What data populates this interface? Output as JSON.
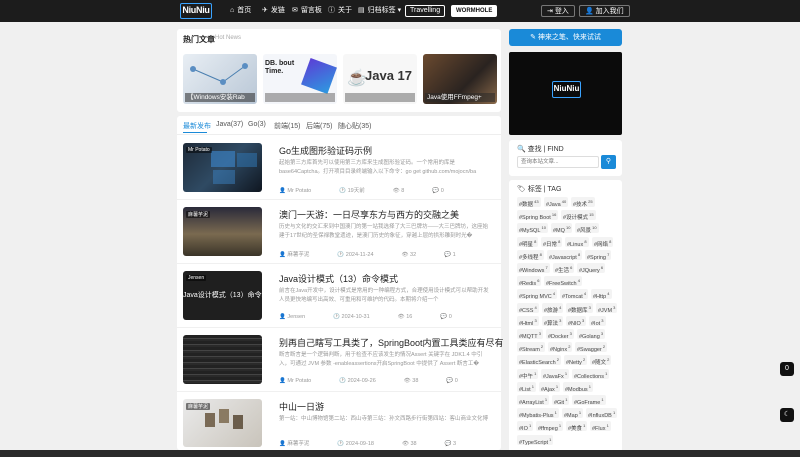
{
  "nav": {
    "logo": "NiuNiu",
    "items": [
      {
        "icon": "home-icon",
        "glyph": "⌂",
        "label": "首页"
      },
      {
        "icon": "send-icon",
        "glyph": "✈",
        "label": "发链"
      },
      {
        "icon": "message-icon",
        "glyph": "✉",
        "label": "留言板"
      },
      {
        "icon": "info-icon",
        "glyph": "ⓘ",
        "label": "关于"
      },
      {
        "icon": "archive-icon",
        "glyph": "▤",
        "label": "归档标签 ▾"
      }
    ],
    "travelling": "Travelling",
    "wormhole": "WORMHOLE",
    "login": "登入",
    "join": "加入我们"
  },
  "hot": {
    "title": "热门文章",
    "subtitle": "Hot News",
    "cards": [
      "【Windows安装Rab",
      "DB. bout Time.",
      "Java 17",
      "Java使用FFmpeg+"
    ]
  },
  "tabs": [
    "最新发布",
    "Java(37)",
    "Go(3)",
    "前端(15)",
    "后端(75)",
    "随心贴(35)"
  ],
  "articles": [
    {
      "thumb_tag": "Mr Potato",
      "title": "Go生成图形验证码示例",
      "desc": "起始第三方库首先可以使用第三方库来生成图形验证码。一个常用的库是base64Captcha。打开项目目录终端输入以下命令：go get github.com/mojocn/ba",
      "author": "Mr Potato",
      "date": "19天前",
      "views": "8",
      "comments": "0"
    },
    {
      "thumb_tag": "麻薯芋泥",
      "title": "澳门一天游：一日尽享东方与西方的交融之美",
      "desc": "历史与文化的交汇来到中国澳门的第一站我选择了大三巴牌坊——大三巴牌坊，这座始建于17世纪的圣保禄教堂遗迹，是澳门历史的象征，穿越上层的拱形雕刻时光�",
      "author": "麻薯芋泥",
      "date": "2024-11-24",
      "views": "32",
      "comments": "1"
    },
    {
      "thumb_tag": "Jensen",
      "title": "Java设计模式（13）命令模式",
      "desc": "前言在Java开发中，设计模式是常用的一种编程方式，合理使用设计模式可以帮助开发人员更快地编写出高效、可重用和可维护的代码。本期将介绍一个",
      "author": "Jensen",
      "date": "2024-10-31",
      "views": "16",
      "comments": "0"
    },
    {
      "thumb_tag": "",
      "title": "别再自己瞎写工具类了，SpringBoot内置工具类应有尽有",
      "desc": "断言断言是一个逻辑判断，用于检查不应该发生的情况Assert 关键字在 JDK1.4 中引入，可通过 JVM 参数 -enableassertions开启SpringBoot 中提供了 Assert 断言工�",
      "author": "Mr Potato",
      "date": "2024-09-26",
      "views": "38",
      "comments": "0"
    },
    {
      "thumb_tag": "麻薯芋泥",
      "title": "中山一日游",
      "desc": "第一站：中山博物馆第二站：西山寺第三站：孙文西路步行街第四站：客山商业文化博物馆",
      "author": "麻薯芋泥",
      "date": "2024-09-18",
      "views": "38",
      "comments": "3"
    }
  ],
  "sidebar": {
    "cta": "神来之笔、快来试试",
    "banner_logo": "NiuNiu",
    "search_title": "查找 | FIND",
    "search_placeholder": "查询本站文章...",
    "tags_title": "标签 | TAG",
    "tags": [
      [
        "#数据",
        "43"
      ],
      [
        "#Java",
        "40"
      ],
      [
        "#技术",
        "25"
      ],
      [
        "#Spring Boot",
        "16"
      ],
      [
        "#设计模式",
        "15"
      ],
      [
        "#MySQL",
        "10"
      ],
      [
        "#MQ",
        "10"
      ],
      [
        "#风景",
        "10"
      ],
      [
        "#明星",
        "8"
      ],
      [
        "#日常",
        "8"
      ],
      [
        "#Linux",
        "8"
      ],
      [
        "#网络",
        "8"
      ],
      [
        "#多线程",
        "8"
      ],
      [
        "#Javascript",
        "8"
      ],
      [
        "#Spring",
        "7"
      ],
      [
        "#Windows",
        "7"
      ],
      [
        "#生活",
        "6"
      ],
      [
        "#JQuery",
        "6"
      ],
      [
        "#Redis",
        "6"
      ],
      [
        "#FreeSwitch",
        "4"
      ],
      [
        "#Spring MVC",
        "4"
      ],
      [
        "#Tomcat",
        "4"
      ],
      [
        "#Http",
        "4"
      ],
      [
        "#CSS",
        "4"
      ],
      [
        "#旅游",
        "4"
      ],
      [
        "#数据库",
        "3"
      ],
      [
        "#JVM",
        "3"
      ],
      [
        "#Html",
        "3"
      ],
      [
        "#算法",
        "3"
      ],
      [
        "#NIO",
        "3"
      ],
      [
        "#Iot",
        "3"
      ],
      [
        "#MQTT",
        "3"
      ],
      [
        "#Docker",
        "3"
      ],
      [
        "#Golang",
        "3"
      ],
      [
        "#Stream",
        "2"
      ],
      [
        "#Nginx",
        "2"
      ],
      [
        "#Swagger",
        "2"
      ],
      [
        "#ElasticSearch",
        "2"
      ],
      [
        "#Netty",
        "2"
      ],
      [
        "#随文",
        "2"
      ],
      [
        "#中午",
        "1"
      ],
      [
        "#JavaFx",
        "1"
      ],
      [
        "#Collections",
        "1"
      ],
      [
        "#List",
        "1"
      ],
      [
        "#Ajax",
        "1"
      ],
      [
        "#Modbus",
        "1"
      ],
      [
        "#ArrayList",
        "1"
      ],
      [
        "#Git",
        "1"
      ],
      [
        "#GoFrame",
        "1"
      ],
      [
        "#Mybatis-Plus",
        "1"
      ],
      [
        "#Map",
        "1"
      ],
      [
        "#InfluxDB",
        "1"
      ],
      [
        "#IO",
        "1"
      ],
      [
        "#ffmpeg",
        "1"
      ],
      [
        "#美食",
        "1"
      ],
      [
        "#Flux",
        "1"
      ],
      [
        "#TypeScript",
        "1"
      ]
    ]
  },
  "float": {
    "top": "0",
    "theme_icon": "moon-icon"
  }
}
